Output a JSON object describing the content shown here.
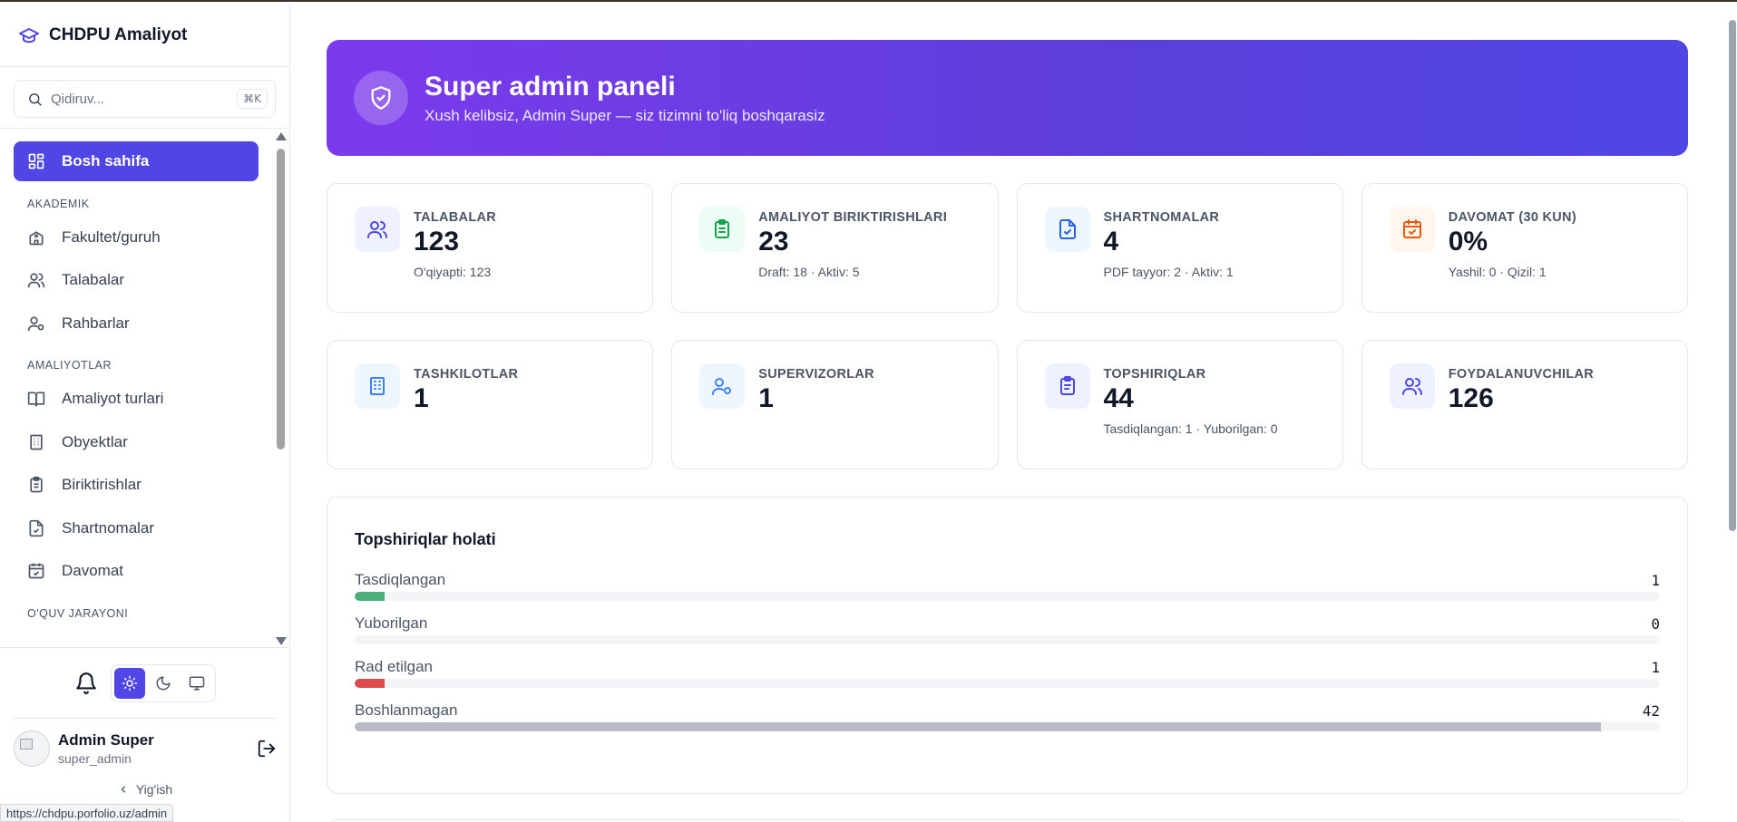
{
  "app": {
    "title": "CHDPU Amaliyot"
  },
  "search": {
    "placeholder": "Qidiruv...",
    "shortcut": "⌘K"
  },
  "sidebar": {
    "home": "Bosh sahifa",
    "section_akademik": "AKADEMIK",
    "akademik": [
      "Fakultet/guruh",
      "Talabalar",
      "Rahbarlar"
    ],
    "section_amaliyot": "AMALIYOTLAR",
    "amaliyot": [
      "Amaliyot turlari",
      "Obyektlar",
      "Biriktirishlar",
      "Shartnomalar",
      "Davomat"
    ],
    "section_oquv": "O'QUV JARAYONI"
  },
  "user": {
    "name": "Admin Super",
    "login": "super_admin",
    "collapse": "Yig'ish"
  },
  "status_url": "https://chdpu.porfolio.uz/admin",
  "hero": {
    "title": "Super admin paneli",
    "subtitle": "Xush kelibsiz, Admin Super — siz tizimni to'liq boshqarasiz"
  },
  "stats": [
    {
      "label": "TALABALAR",
      "value": "123",
      "sub": "O'qiyapti: 123",
      "icon": "users-icon",
      "bg": "#eef2ff",
      "color": "#4f46e5"
    },
    {
      "label": "AMALIYOT BIRIKTIRISHLARI",
      "value": "23",
      "sub": "Draft: 18 · Aktiv: 5",
      "icon": "clipboard-list-icon",
      "bg": "#ecfdf5",
      "color": "#16a34a"
    },
    {
      "label": "SHARTNOMALAR",
      "value": "4",
      "sub": "PDF tayyor: 2 · Aktiv: 1",
      "icon": "file-check-icon",
      "bg": "#eff6ff",
      "color": "#2563eb"
    },
    {
      "label": "DAVOMAT (30 KUN)",
      "value": "0%",
      "sub": "Yashil: 0 · Qizil: 1",
      "icon": "calendar-check-icon",
      "bg": "#fff7ed",
      "color": "#ea580c"
    },
    {
      "label": "TASHKILOTLAR",
      "value": "1",
      "sub": "",
      "icon": "building-icon",
      "bg": "#eff6ff",
      "color": "#3b82f6"
    },
    {
      "label": "SUPERVIZORLAR",
      "value": "1",
      "sub": "",
      "icon": "user-cog-icon",
      "bg": "#eff6ff",
      "color": "#3b82f6"
    },
    {
      "label": "TOPSHIRIQLAR",
      "value": "44",
      "sub": "Tasdiqlangan: 1 · Yuborilgan: 0",
      "icon": "clipboard-icon",
      "bg": "#eef2ff",
      "color": "#4f46e5"
    },
    {
      "label": "FOYDALANUVCHILAR",
      "value": "126",
      "sub": "",
      "icon": "users-icon",
      "bg": "#eef2ff",
      "color": "#4f46e5"
    }
  ],
  "tasks": {
    "title": "Topshiriqlar holati",
    "rows": [
      {
        "label": "Tasdiqlangan",
        "count": "1",
        "fraction": 0.023,
        "color": "#4caf7a"
      },
      {
        "label": "Yuborilgan",
        "count": "0",
        "fraction": 0,
        "color": "#9ca3af"
      },
      {
        "label": "Rad etilgan",
        "count": "1",
        "fraction": 0.023,
        "color": "#dc4c4c"
      },
      {
        "label": "Boshlanmagan",
        "count": "42",
        "fraction": 0.955,
        "color": "#b8bcc6"
      }
    ]
  }
}
